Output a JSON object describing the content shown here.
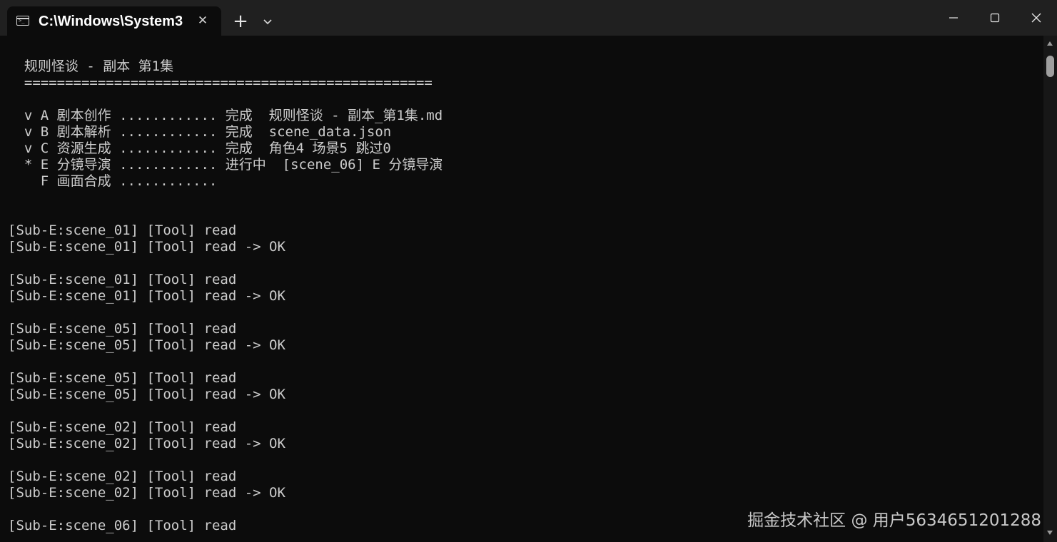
{
  "tab": {
    "title": "C:\\Windows\\System3",
    "close_label": "✕",
    "new_tab_label": "+"
  },
  "terminal": {
    "lines": [
      "  规则怪谈 - 副本 第1集",
      "  ==================================================",
      "",
      "  v A 剧本创作 ............ 完成  规则怪谈 - 副本_第1集.md",
      "  v B 剧本解析 ............ 完成  scene_data.json",
      "  v C 资源生成 ............ 完成  角色4 场景5 跳过0",
      "  * E 分镜导演 ............ 进行中  [scene_06] E 分镜导演",
      "    F 画面合成 ............",
      "",
      "",
      "[Sub-E:scene_01] [Tool] read",
      "[Sub-E:scene_01] [Tool] read -> OK",
      "",
      "[Sub-E:scene_01] [Tool] read",
      "[Sub-E:scene_01] [Tool] read -> OK",
      "",
      "[Sub-E:scene_05] [Tool] read",
      "[Sub-E:scene_05] [Tool] read -> OK",
      "",
      "[Sub-E:scene_05] [Tool] read",
      "[Sub-E:scene_05] [Tool] read -> OK",
      "",
      "[Sub-E:scene_02] [Tool] read",
      "[Sub-E:scene_02] [Tool] read -> OK",
      "",
      "[Sub-E:scene_02] [Tool] read",
      "[Sub-E:scene_02] [Tool] read -> OK",
      "",
      "[Sub-E:scene_06] [Tool] read"
    ]
  },
  "watermark": "掘金技术社区 @ 用户5634651201288",
  "colors": {
    "titlebar_bg": "#202020",
    "terminal_bg": "#0c0c0c",
    "text": "#cccccc"
  },
  "icons": {
    "tab_icon": "terminal-icon",
    "dropdown": "chevron-down-icon",
    "minimize": "minimize-icon",
    "maximize": "maximize-icon",
    "close": "close-icon"
  }
}
